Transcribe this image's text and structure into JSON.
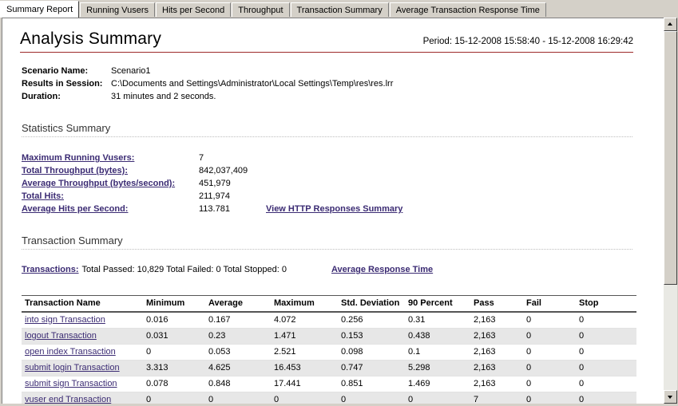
{
  "tabs": [
    {
      "label": "Summary Report",
      "active": true
    },
    {
      "label": "Running Vusers",
      "active": false
    },
    {
      "label": "Hits per Second",
      "active": false
    },
    {
      "label": "Throughput",
      "active": false
    },
    {
      "label": "Transaction Summary",
      "active": false
    },
    {
      "label": "Average Transaction Response Time",
      "active": false
    }
  ],
  "report": {
    "title": "Analysis Summary",
    "period": "Period: 15-12-2008 15:58:40 - 15-12-2008 16:29:42",
    "meta": [
      {
        "label": "Scenario Name:",
        "value": "Scenario1"
      },
      {
        "label": "Results in Session:",
        "value": "C:\\Documents and Settings\\Administrator\\Local Settings\\Temp\\res\\res.lrr"
      },
      {
        "label": "Duration:",
        "value": "31 minutes and 2 seconds."
      }
    ],
    "statistics": {
      "heading": "Statistics Summary",
      "rows": [
        {
          "label": "Maximum Running Vusers:",
          "value": "7"
        },
        {
          "label": "Total Throughput (bytes):",
          "value": "842,037,409"
        },
        {
          "label": "Average Throughput (bytes/second):",
          "value": "451,979"
        },
        {
          "label": "Total Hits:",
          "value": "211,974"
        },
        {
          "label": "Average Hits per Second:",
          "value": "113.781"
        }
      ],
      "http_link": "View HTTP Responses Summary"
    },
    "transaction_summary": {
      "heading": "Transaction Summary",
      "transactions_label": "Transactions:",
      "transactions_text": "Total Passed: 10,829 Total Failed: 0 Total Stopped: 0",
      "avg_response_link": "Average Response Time",
      "columns": [
        "Transaction Name",
        "Minimum",
        "Average",
        "Maximum",
        "Std. Deviation",
        "90 Percent",
        "Pass",
        "Fail",
        "Stop"
      ],
      "rows": [
        {
          "name": "into sign Transaction",
          "minimum": "0.016",
          "average": "0.167",
          "maximum": "4.072",
          "std_deviation": "0.256",
          "percent90": "0.31",
          "pass": "2,163",
          "fail": "0",
          "stop": "0"
        },
        {
          "name": "logout Transaction",
          "minimum": "0.031",
          "average": "0.23",
          "maximum": "1.471",
          "std_deviation": "0.153",
          "percent90": "0.438",
          "pass": "2,163",
          "fail": "0",
          "stop": "0"
        },
        {
          "name": "open index Transaction",
          "minimum": "0",
          "average": "0.053",
          "maximum": "2.521",
          "std_deviation": "0.098",
          "percent90": "0.1",
          "pass": "2,163",
          "fail": "0",
          "stop": "0"
        },
        {
          "name": "submit login Transaction",
          "minimum": "3.313",
          "average": "4.625",
          "maximum": "16.453",
          "std_deviation": "0.747",
          "percent90": "5.298",
          "pass": "2,163",
          "fail": "0",
          "stop": "0"
        },
        {
          "name": "submit sign Transaction",
          "minimum": "0.078",
          "average": "0.848",
          "maximum": "17.441",
          "std_deviation": "0.851",
          "percent90": "1.469",
          "pass": "2,163",
          "fail": "0",
          "stop": "0"
        },
        {
          "name": "vuser end Transaction",
          "minimum": "0",
          "average": "0",
          "maximum": "0",
          "std_deviation": "0",
          "percent90": "0",
          "pass": "7",
          "fail": "0",
          "stop": "0"
        }
      ]
    }
  },
  "scrollbar": {
    "up_icon": "triangle-up-icon",
    "down_icon": "triangle-down-icon"
  },
  "colors": {
    "title_rule": "#9e2a2a",
    "link": "#3b2b73",
    "chrome": "#d4d0c8",
    "row_alt": "#e7e7e7"
  }
}
